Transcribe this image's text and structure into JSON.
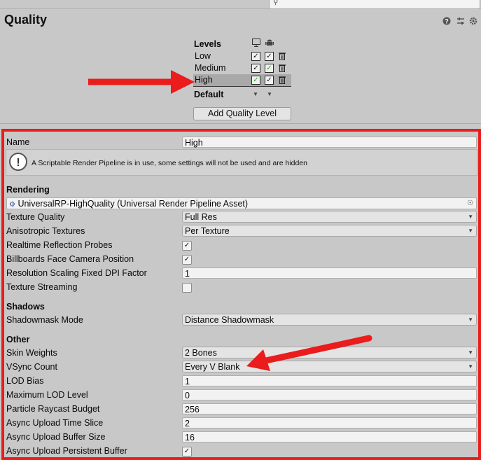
{
  "search": {
    "placeholder": "",
    "icon": "search-icon"
  },
  "header": {
    "title": "Quality",
    "icons": [
      "help-icon",
      "presets-icon",
      "gear-icon"
    ]
  },
  "levels": {
    "heading": "Levels",
    "platform_icons": [
      "desktop-icon",
      "android-icon"
    ],
    "rows": [
      {
        "name": "Low",
        "desktop": true,
        "android": true,
        "selected": false
      },
      {
        "name": "Medium",
        "desktop": true,
        "android": true,
        "selected": false
      },
      {
        "name": "High",
        "desktop": true,
        "android": true,
        "selected": true
      }
    ],
    "default_label": "Default",
    "add_button": "Add Quality Level"
  },
  "settings": {
    "name_label": "Name",
    "name_value": "High",
    "help_message": "A Scriptable Render Pipeline is in use, some settings will not be used and are hidden",
    "rendering": {
      "heading": "Rendering",
      "pipeline_asset": "UniversalRP-HighQuality (Universal Render Pipeline Asset)",
      "texture_quality_label": "Texture Quality",
      "texture_quality_value": "Full Res",
      "anisotropic_label": "Anisotropic Textures",
      "anisotropic_value": "Per Texture",
      "realtime_reflection_label": "Realtime Reflection Probes",
      "realtime_reflection_checked": true,
      "billboards_label": "Billboards Face Camera Position",
      "billboards_checked": true,
      "dpi_label": "Resolution Scaling Fixed DPI Factor",
      "dpi_value": "1",
      "streaming_label": "Texture Streaming",
      "streaming_checked": false
    },
    "shadows": {
      "heading": "Shadows",
      "shadowmask_label": "Shadowmask Mode",
      "shadowmask_value": "Distance Shadowmask"
    },
    "other": {
      "heading": "Other",
      "skin_label": "Skin Weights",
      "skin_value": "2 Bones",
      "vsync_label": "VSync Count",
      "vsync_value": "Every V Blank",
      "lod_bias_label": "LOD Bias",
      "lod_bias_value": "1",
      "max_lod_label": "Maximum LOD Level",
      "max_lod_value": "0",
      "raycast_label": "Particle Raycast Budget",
      "raycast_value": "256",
      "time_slice_label": "Async Upload Time Slice",
      "time_slice_value": "2",
      "buffer_size_label": "Async Upload Buffer Size",
      "buffer_size_value": "16",
      "persistent_label": "Async Upload Persistent Buffer",
      "persistent_checked": true
    }
  },
  "colors": {
    "highlight": "#ea1c1c",
    "green_check": "#2aa52a"
  }
}
